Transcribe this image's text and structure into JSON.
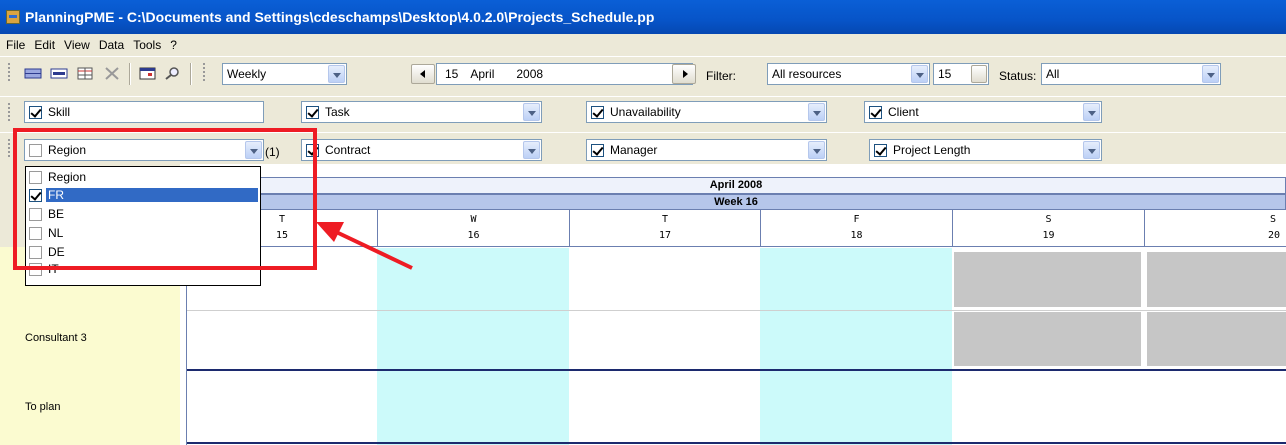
{
  "window": {
    "title": "PlanningPME - C:\\Documents and Settings\\cdeschamps\\Desktop\\4.0.2.0\\Projects_Schedule.pp"
  },
  "menu": [
    "File",
    "Edit",
    "View",
    "Data",
    "Tools",
    "?"
  ],
  "toolbar": {
    "view_mode": "Weekly",
    "date_day": "15",
    "date_month": "April",
    "date_year": "2008",
    "filter_label": "Filter:",
    "filter_value": "All resources",
    "spin_value": "15",
    "status_label": "Status:",
    "status_value": "All"
  },
  "filters_row1": [
    {
      "label": "Skill",
      "checked": true
    },
    {
      "label": "Task",
      "checked": true
    },
    {
      "label": "Unavailability",
      "checked": true
    },
    {
      "label": "Client",
      "checked": true
    }
  ],
  "filters_row2": [
    {
      "label": "Region",
      "checked": false,
      "count": "(1)"
    },
    {
      "label": "Contract",
      "checked": true
    },
    {
      "label": "Manager",
      "checked": true
    },
    {
      "label": "Project Length",
      "checked": true
    }
  ],
  "region_dropdown": {
    "items": [
      {
        "label": "Region",
        "checked": false,
        "selected": false
      },
      {
        "label": "FR",
        "checked": true,
        "selected": true
      },
      {
        "label": "BE",
        "checked": false,
        "selected": false
      },
      {
        "label": "NL",
        "checked": false,
        "selected": false
      },
      {
        "label": "DE",
        "checked": false,
        "selected": false
      },
      {
        "label": "IT",
        "checked": false,
        "selected": false
      }
    ]
  },
  "schedule": {
    "month": "April 2008",
    "week": "Week 16",
    "days": [
      {
        "letter": "T",
        "number": "15"
      },
      {
        "letter": "W",
        "number": "16"
      },
      {
        "letter": "T",
        "number": "17"
      },
      {
        "letter": "F",
        "number": "18"
      },
      {
        "letter": "S",
        "number": "19"
      },
      {
        "letter": "S",
        "number": "20"
      }
    ],
    "rows": [
      "Consultant 3",
      "To plan"
    ]
  },
  "colors": {
    "highlight": "#ee1c24",
    "selection": "#316ac5",
    "weekday_shade": "#ccfafa",
    "weekend_shade": "#c6c6c6",
    "resource_column": "#fbfbd0"
  }
}
